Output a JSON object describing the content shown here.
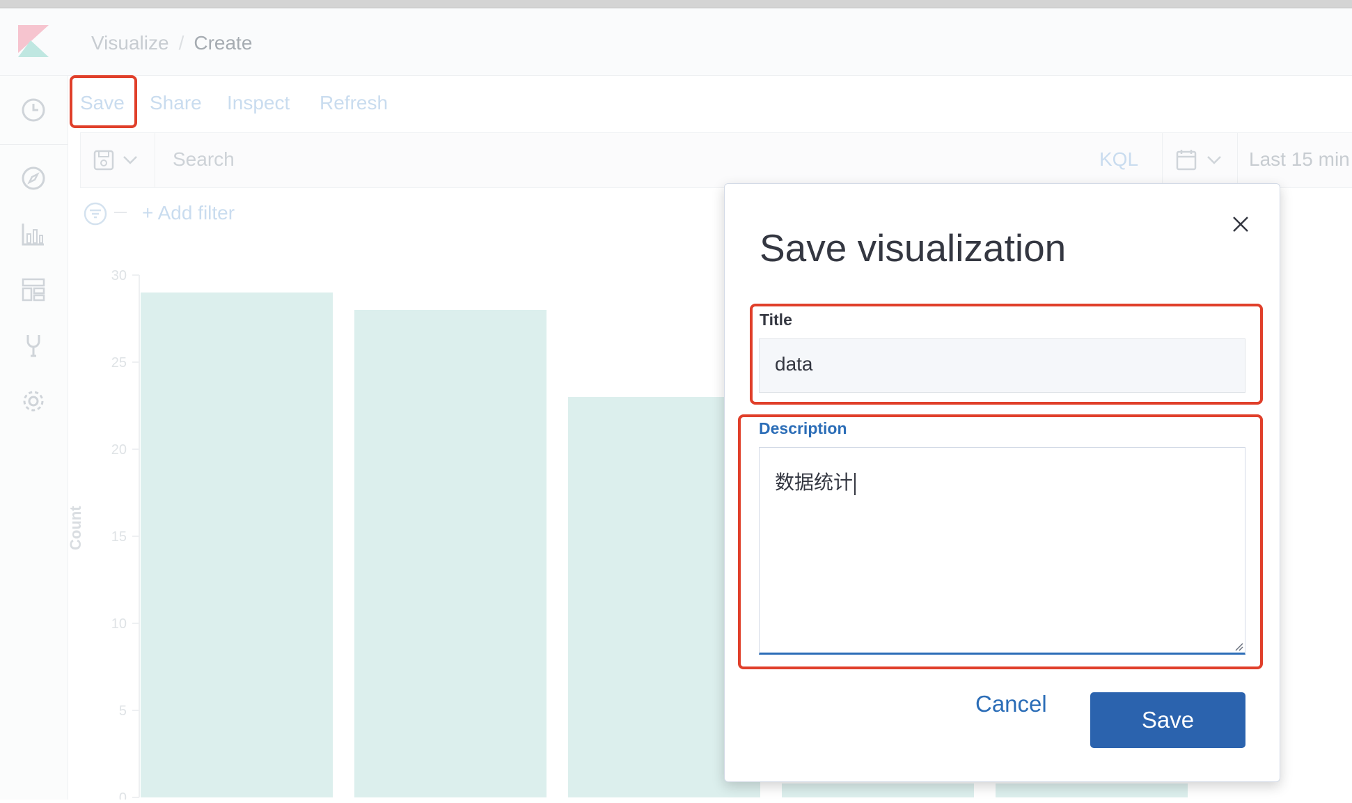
{
  "breadcrumb": {
    "parent": "Visualize",
    "current": "Create"
  },
  "top_menu": {
    "save": "Save",
    "share": "Share",
    "inspect": "Inspect",
    "refresh": "Refresh"
  },
  "query_bar": {
    "search_placeholder": "Search",
    "language": "KQL",
    "time_range": "Last 15 min"
  },
  "filter": {
    "add_label": "+ Add filter"
  },
  "chart_data": {
    "type": "bar",
    "ylabel": "Count",
    "ylim": [
      0,
      30
    ],
    "y_ticks": [
      "30",
      "25",
      "20",
      "15",
      "10",
      "5",
      "0"
    ],
    "values": [
      29,
      28,
      23,
      null,
      null
    ]
  },
  "modal": {
    "title": "Save visualization",
    "title_label": "Title",
    "title_value": "data",
    "description_label": "Description",
    "description_value": "数据统计",
    "cancel_label": "Cancel",
    "save_label": "Save"
  },
  "colors": {
    "accent": "#2b63ae",
    "highlight": "#e03f2a",
    "bar": "#dcefed"
  },
  "icons": [
    "kibana-logo-icon",
    "clock-icon",
    "compass-icon",
    "chart-icon",
    "dashboard-icon",
    "dev-tools-icon",
    "gear-icon",
    "save-query-icon",
    "calendar-icon",
    "filter-icon",
    "close-icon"
  ]
}
